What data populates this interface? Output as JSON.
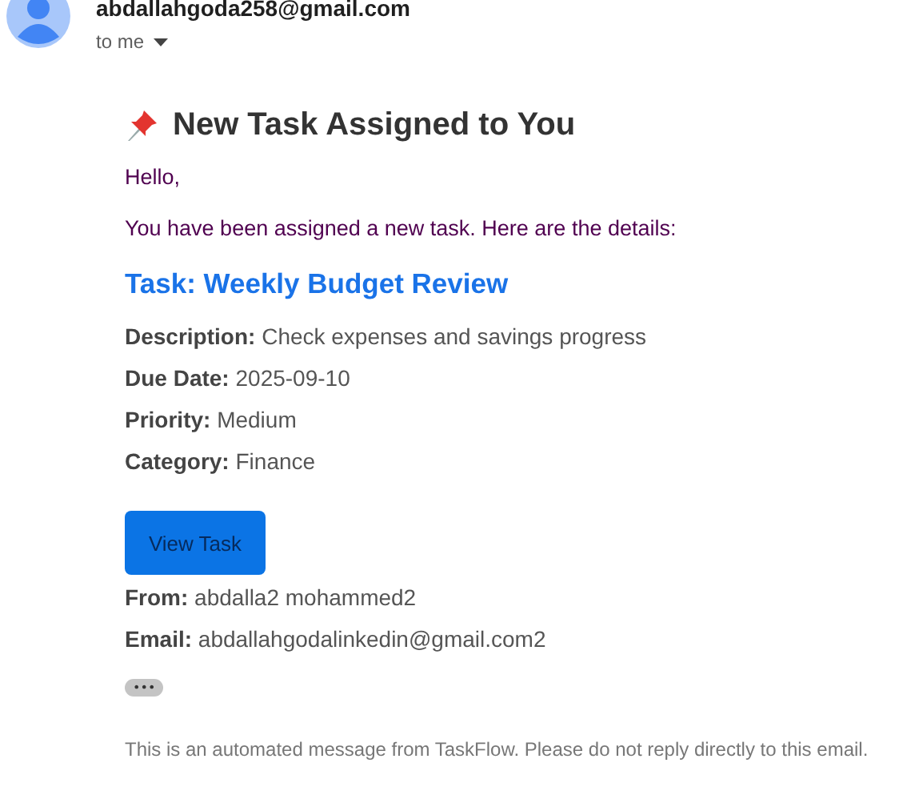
{
  "sender": {
    "email": "abdallahgoda258@gmail.com",
    "recipient": "to me"
  },
  "message": {
    "heading": "New Task Assigned to You",
    "greeting": "Hello,",
    "intro": "You have been assigned a new task. Here are the details:",
    "task_title": "Task: Weekly Budget Review",
    "details": [
      {
        "label": "Description:",
        "value": "Check expenses and savings progress"
      },
      {
        "label": "Due Date:",
        "value": "2025-09-10"
      },
      {
        "label": "Priority:",
        "value": "Medium"
      },
      {
        "label": "Category:",
        "value": "Finance"
      }
    ],
    "button": "View Task",
    "contacts": [
      {
        "label": "From:",
        "value": "abdalla2 mohammed2"
      },
      {
        "label": "Email:",
        "value": "abdallahgodalinkedin@gmail.com2"
      }
    ],
    "more": "•••",
    "footer": "This is an automated message from TaskFlow. Please do not reply directly to this email."
  }
}
